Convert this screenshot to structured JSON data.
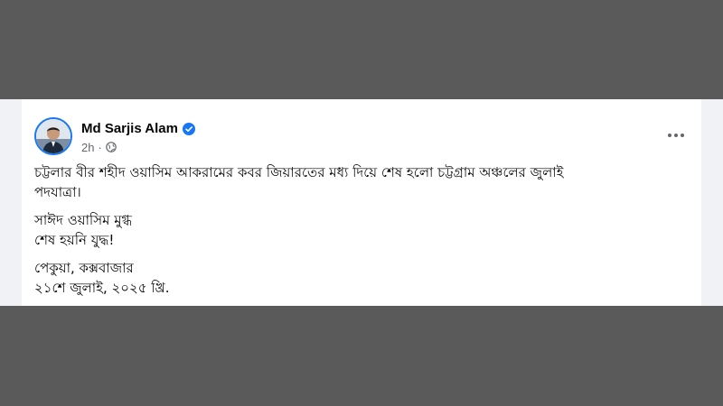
{
  "post": {
    "author": "Md Sarjis Alam",
    "time": "2h",
    "meta_separator": "·",
    "privacy_icon": "globe-icon",
    "verified_icon": "verified-badge-icon",
    "more_icon": "more-horizontal-icon",
    "paragraphs": [
      {
        "lines": [
          "চট্টলার বীর শহীদ ওয়াসিম আকরামের কবর জিয়ারতের মধ্য দিয়ে শেষ হলো চট্টগ্রাম অঞ্চলের জুলাই",
          "পদযাত্রা।"
        ]
      },
      {
        "lines": [
          "সাঈদ ওয়াসিম মুগ্ধ",
          "শেষ হয়নি যুদ্ধ!"
        ]
      },
      {
        "lines": [
          "পেকুয়া, কক্সবাজার",
          "২১শে জুলাই, ২০২৫ খ্রি."
        ]
      }
    ]
  },
  "colors": {
    "background_band": "#5a5a5a",
    "card": "#ffffff",
    "text": "#050505",
    "secondary_text": "#65676b",
    "accent": "#1877f2"
  }
}
